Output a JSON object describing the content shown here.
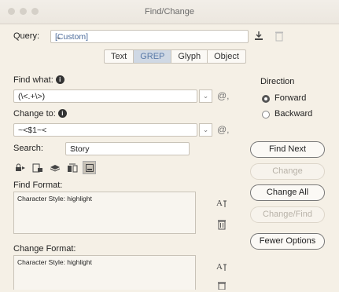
{
  "window": {
    "title": "Find/Change"
  },
  "query": {
    "label": "Query:",
    "value": "[Custom]",
    "save_icon": "save-query-icon",
    "delete_icon": "delete-query-icon"
  },
  "tabs": [
    {
      "label": "Text",
      "active": false
    },
    {
      "label": "GREP",
      "active": true
    },
    {
      "label": "Glyph",
      "active": false
    },
    {
      "label": "Object",
      "active": false
    }
  ],
  "find_what": {
    "label": "Find what:",
    "value": "(\\<.+\\>)"
  },
  "change_to": {
    "label": "Change to:",
    "value": "~<$1~<"
  },
  "special_char_symbol": "@,",
  "search": {
    "label": "Search:",
    "value": "Story"
  },
  "direction": {
    "label": "Direction",
    "forward": "Forward",
    "backward": "Backward",
    "selected": "Forward"
  },
  "buttons": {
    "find_next": "Find Next",
    "change": "Change",
    "change_all": "Change All",
    "change_find": "Change/Find",
    "fewer_options": "Fewer Options"
  },
  "find_format": {
    "label": "Find Format:",
    "value": "Character Style: highlight"
  },
  "change_format": {
    "label": "Change Format:",
    "value": "Character Style: highlight"
  },
  "colors": {
    "active_tab_bg": "#cfd8e4",
    "active_tab_text": "#5a7aa8",
    "background": "#f5f0e6"
  }
}
